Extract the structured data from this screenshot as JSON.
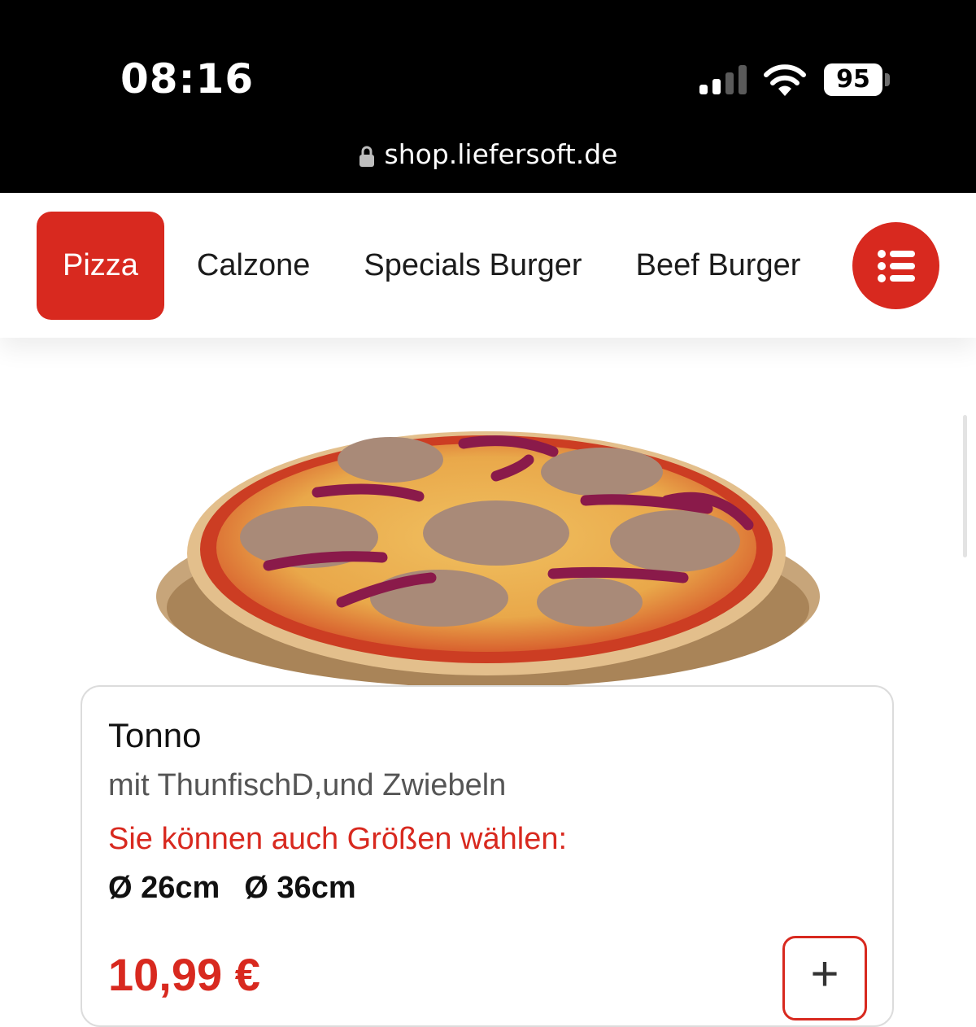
{
  "status_bar": {
    "time": "08:16",
    "battery": "95"
  },
  "browser": {
    "url": "shop.liefersoft.de"
  },
  "categories": [
    {
      "label": "Pizza",
      "active": true
    },
    {
      "label": "Calzone",
      "active": false
    },
    {
      "label": "Specials Burger",
      "active": false
    },
    {
      "label": "Beef Burger",
      "active": false
    }
  ],
  "menu_icon": "list-icon",
  "accent_color": "#d8291f",
  "product": {
    "name": "Tonno",
    "description": "mit ThunfischD,und Zwiebeln",
    "size_note": "Sie können auch Größen wählen:",
    "sizes": [
      "Ø 26cm",
      "Ø 36cm"
    ],
    "price": "10,99 €",
    "add_icon": "plus-icon",
    "add_label": "+"
  }
}
